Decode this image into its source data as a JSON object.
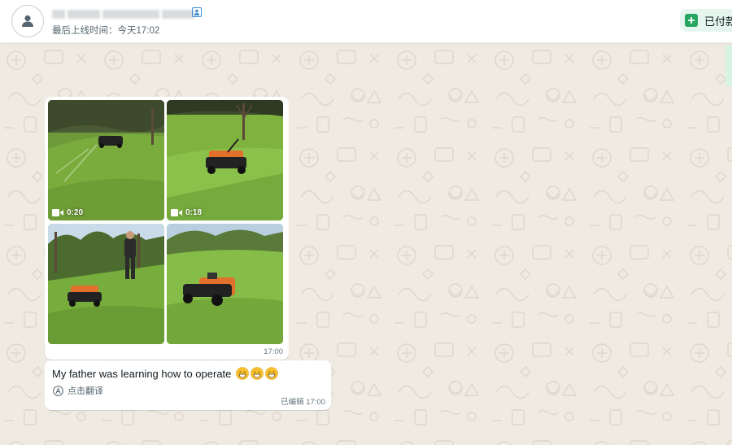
{
  "header": {
    "contact_name": "[██] ██████ ████",
    "last_seen": "最后上线时间：今天17:02",
    "paid_button_label": "已付款"
  },
  "icons": {
    "avatar": "person-avatar-icon",
    "contact_card": "contact-card-icon",
    "paid": "plus-square-icon",
    "video": "video-camera-icon",
    "translate": "translate-icon",
    "emoji": "grinning-face-emoji"
  },
  "colors": {
    "chat_background": "#efeae2",
    "bubble": "#ffffff",
    "accent_green": "#25a55f",
    "paid_bg": "#e6f6ee",
    "meta_text": "#667781"
  },
  "messages": [
    {
      "type": "media_album",
      "tiles": [
        {
          "kind": "video",
          "duration": "0:20"
        },
        {
          "kind": "video",
          "duration": "0:18"
        },
        {
          "kind": "image",
          "duration": ""
        },
        {
          "kind": "image",
          "duration": ""
        }
      ],
      "time": "17:00"
    },
    {
      "type": "text",
      "text": "My father was learning how to operate",
      "emoji_count": 3,
      "translate_label": "点击翻译",
      "edited_label": "已编辑",
      "time": "17:00",
      "edited_meta": "已编辑 17:00"
    }
  ]
}
